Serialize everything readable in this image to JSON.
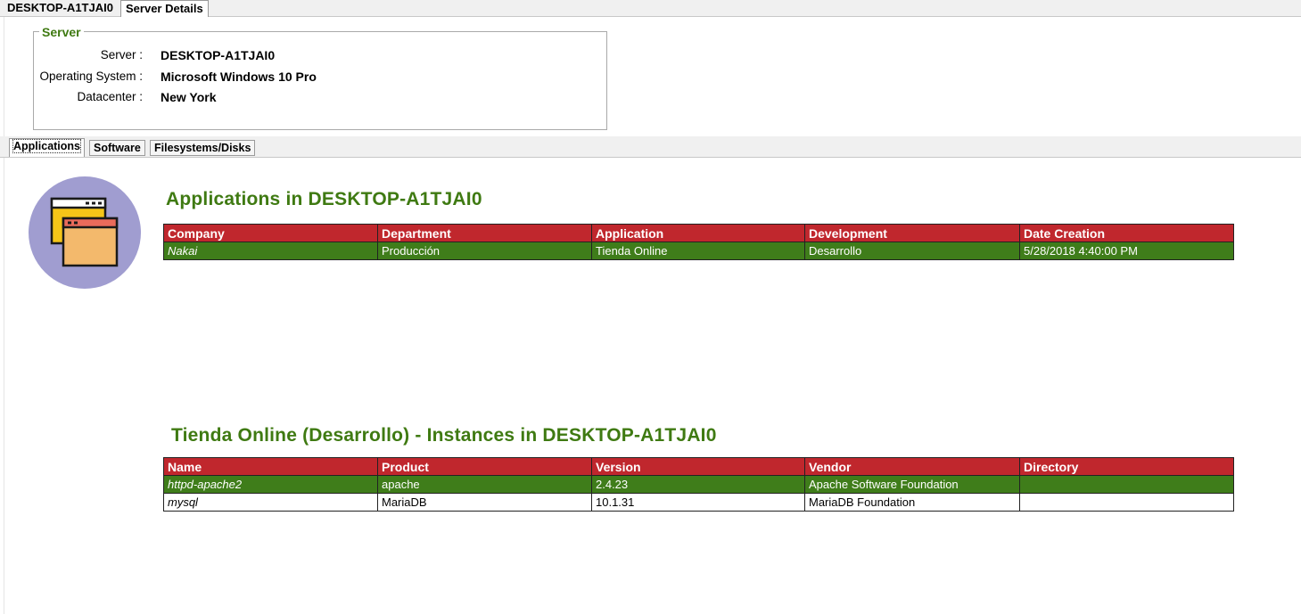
{
  "top_tabs": [
    "DESKTOP-A1TJAI0",
    "Server Details"
  ],
  "server_box": {
    "legend": "Server",
    "fields": [
      {
        "label": "Server :",
        "value": "DESKTOP-A1TJAI0"
      },
      {
        "label": "Operating System :",
        "value": "Microsoft Windows 10 Pro"
      },
      {
        "label": "Datacenter :",
        "value": "New York"
      }
    ]
  },
  "inner_tabs": [
    "Applications",
    "Software",
    "Filesystems/Disks"
  ],
  "icon": "application-windows-icon",
  "applications": {
    "title": "Applications in DESKTOP-A1TJAI0",
    "columns": [
      "Company",
      "Department",
      "Application",
      "Development",
      "Date Creation"
    ],
    "rows": [
      [
        "Nakai",
        "Producción",
        "Tienda Online",
        "Desarrollo",
        "5/28/2018 4:40:00 PM"
      ]
    ]
  },
  "instances": {
    "title": "Tienda Online (Desarrollo) - Instances in DESKTOP-A1TJAI0",
    "columns": [
      "Name",
      "Product",
      "Version",
      "Vendor",
      "Directory"
    ],
    "rows": [
      [
        "httpd-apache2",
        "apache",
        "2.4.23",
        "Apache Software Foundation",
        ""
      ],
      [
        "mysql",
        "MariaDB",
        "10.1.31",
        "MariaDB Foundation",
        ""
      ]
    ]
  },
  "colors": {
    "accent_green": "#3f7a12",
    "header_red": "#c0272d",
    "selected_row": "#3f7d1a"
  }
}
